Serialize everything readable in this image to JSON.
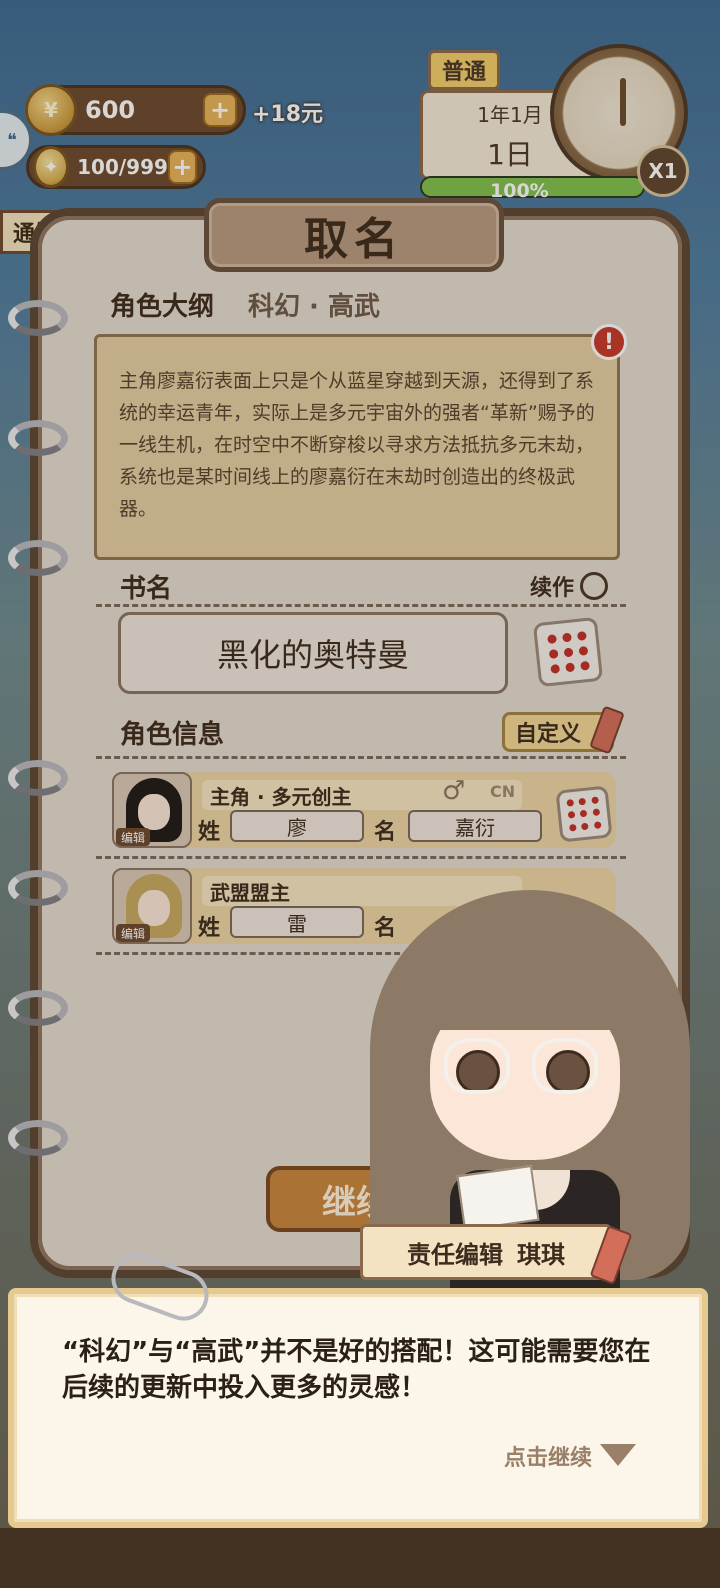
{
  "hud": {
    "coins": "600",
    "coin_bonus": "+18元",
    "energy": "100/999",
    "mode": "普通",
    "date_month": "1年1月",
    "date_day": "1日",
    "progress": "100%",
    "progress_value": 1.0,
    "speed": "X1",
    "notify_tab": "通知"
  },
  "panel": {
    "title": "取名",
    "outline_label": "角色大纲",
    "genre": "科幻 · 高武",
    "summary": "主角廖嘉衍表面上只是个从蓝星穿越到天源，还得到了系统的幸运青年，实际上是多元宇宙外的强者“革新”赐予的一线生机，在时空中不断穿梭以寻求方法抵抗多元末劫，系统也是某时间线上的廖嘉衍在末劫时创造出的终极武器。",
    "book_name_label": "书名",
    "sequel_label": "续作",
    "book_name": "黑化的奥特曼",
    "char_info_label": "角色信息",
    "custom_label": "自定义",
    "characters": [
      {
        "role": "主角 · 多元创主",
        "edit": "编辑",
        "surname_label": "姓",
        "surname": "廖",
        "given_label": "名",
        "given": "嘉衍",
        "gender": "♂",
        "region": "CN"
      },
      {
        "role": "武盟盟主",
        "edit": "编辑",
        "surname_label": "姓",
        "surname": "雷",
        "given_label": "名"
      }
    ],
    "continue_label": "继续"
  },
  "editor": {
    "title": "责任编辑",
    "name": "琪琪"
  },
  "dialog": {
    "text": "“科幻”与“高武”并不是好的搭配！这可能需要您在后续的更新中投入更多的灵感！",
    "tap_continue": "点击继续"
  },
  "colors": {
    "panel_bg": "#e4dcd1",
    "frame": "#5b4634",
    "accent": "#c8853e",
    "warning": "#c63a2b",
    "progress": "#7ec04e"
  }
}
